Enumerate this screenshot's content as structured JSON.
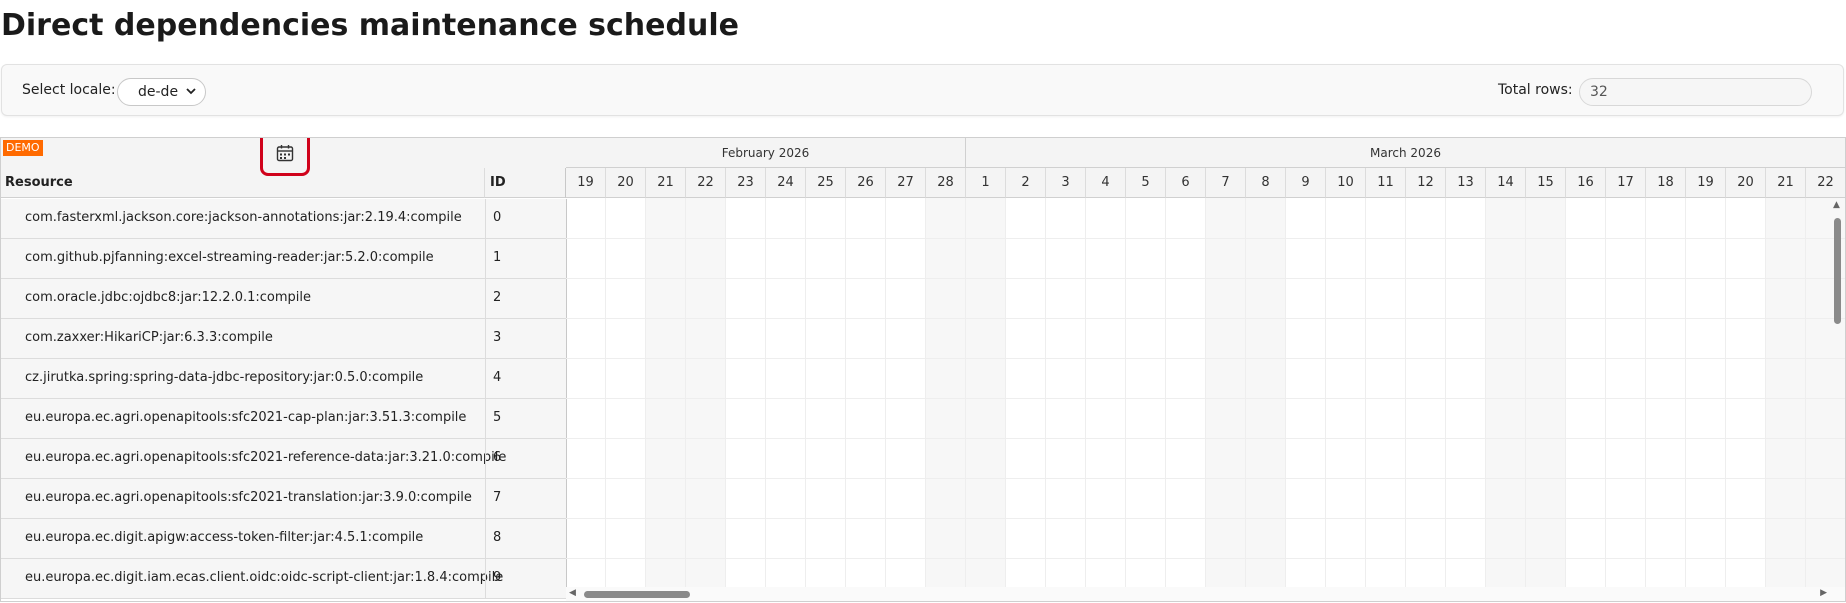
{
  "page": {
    "title": "Direct dependencies maintenance schedule"
  },
  "toolbar": {
    "locale_label": "Select locale:",
    "locale_value": "de-de",
    "total_rows_label": "Total rows:",
    "total_rows_value": "32"
  },
  "grid": {
    "demo_badge": "DEMO",
    "calendar_icon": "calendar-icon",
    "columns": {
      "resource": "Resource",
      "id": "ID"
    },
    "months": [
      {
        "label": "February 2026",
        "days": [
          "19",
          "20",
          "21",
          "22",
          "23",
          "24",
          "25",
          "26",
          "27",
          "28"
        ]
      },
      {
        "label": "March 2026",
        "days": [
          "1",
          "2",
          "3",
          "4",
          "5",
          "6",
          "7",
          "8",
          "9",
          "10",
          "11",
          "12",
          "13",
          "14",
          "15",
          "16",
          "17",
          "18",
          "19",
          "20",
          "21",
          "22"
        ]
      }
    ],
    "weekend_days": [
      "February 2026:21",
      "February 2026:22",
      "February 2026:28",
      "March 2026:1",
      "March 2026:7",
      "March 2026:8",
      "March 2026:14",
      "March 2026:15",
      "March 2026:21",
      "March 2026:22"
    ],
    "rows": [
      {
        "resource": "com.fasterxml.jackson.core:jackson-annotations:jar:2.19.4:compile",
        "id": "0"
      },
      {
        "resource": "com.github.pjfanning:excel-streaming-reader:jar:5.2.0:compile",
        "id": "1"
      },
      {
        "resource": "com.oracle.jdbc:ojdbc8:jar:12.2.0.1:compile",
        "id": "2"
      },
      {
        "resource": "com.zaxxer:HikariCP:jar:6.3.3:compile",
        "id": "3"
      },
      {
        "resource": "cz.jirutka.spring:spring-data-jdbc-repository:jar:0.5.0:compile",
        "id": "4"
      },
      {
        "resource": "eu.europa.ec.agri.openapitools:sfc2021-cap-plan:jar:3.51.3:compile",
        "id": "5"
      },
      {
        "resource": "eu.europa.ec.agri.openapitools:sfc2021-reference-data:jar:3.21.0:compile",
        "id": "6"
      },
      {
        "resource": "eu.europa.ec.agri.openapitools:sfc2021-translation:jar:3.9.0:compile",
        "id": "7"
      },
      {
        "resource": "eu.europa.ec.digit.apigw:access-token-filter:jar:4.5.1:compile",
        "id": "8"
      },
      {
        "resource": "eu.europa.ec.digit.iam.ecas.client.oidc:oidc-script-client:jar:1.8.4:compile",
        "id": "9"
      }
    ]
  },
  "colors": {
    "accent": "#ff6a00",
    "highlight": "#d0021b",
    "header_bg": "#f4f4f4"
  }
}
